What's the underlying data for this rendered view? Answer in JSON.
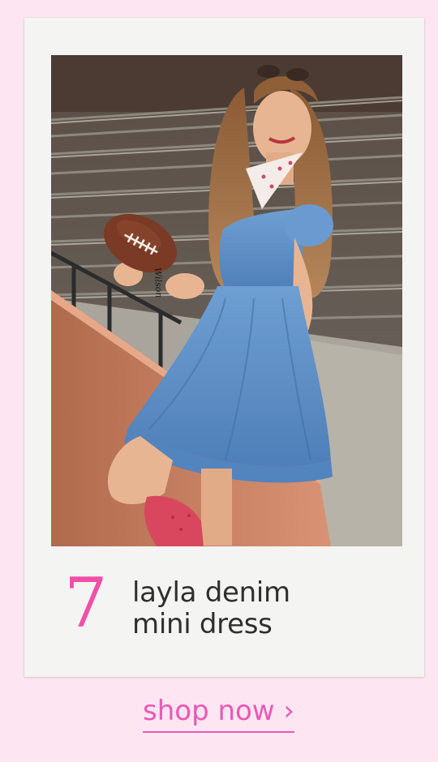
{
  "card": {
    "number": "7",
    "title_line_1": "layla denim",
    "title_line_2": "mini dress",
    "football_brand": "Wilson"
  },
  "cta": {
    "label": "shop now ›"
  },
  "colors": {
    "page_background": "#fde6f2",
    "polaroid_frame": "#f4f4f2",
    "accent_pink": "#f24fa8",
    "cta_pink": "#ea58b4",
    "title_text": "#2f2f2f",
    "dress_denim": "#5f8fc4",
    "boots": "#d9475f"
  }
}
